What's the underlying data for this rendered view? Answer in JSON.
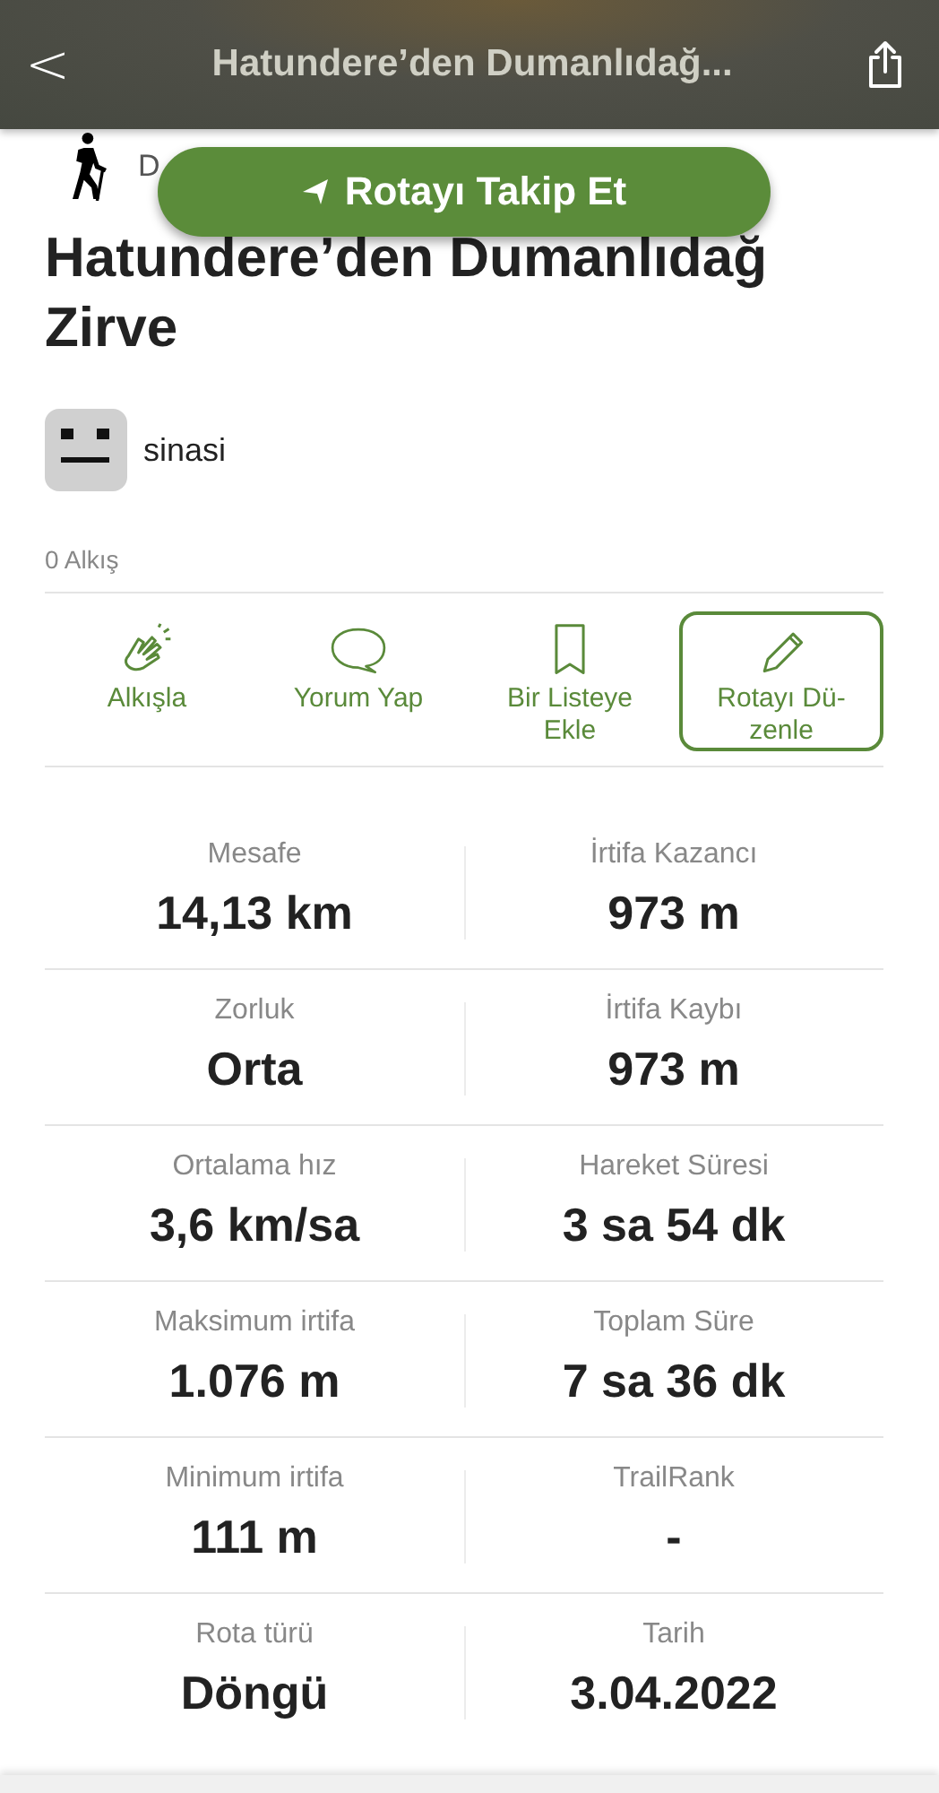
{
  "header": {
    "back": "<",
    "title": "Hatundere’den Dumanlıdağ..."
  },
  "activity": {
    "label": "D"
  },
  "follow_button": {
    "label": "Rotayı Takip Et"
  },
  "title": "Hatundere’den Dumanlıdağ Zirve",
  "author": {
    "name": "sinasi"
  },
  "claps": "0 Alkış",
  "actions": [
    {
      "kind": "clap",
      "label": "Alkışla",
      "selected": false
    },
    {
      "kind": "comment",
      "label": "Yorum Yap",
      "selected": false
    },
    {
      "kind": "bookmark",
      "label": "Bir Listeye Ekle",
      "selected": false
    },
    {
      "kind": "edit",
      "label": "Rotayı Dü-zenle",
      "selected": true
    }
  ],
  "stats": [
    {
      "label": "Mesafe",
      "value": "14,13 km"
    },
    {
      "label": "İrtifa Kazancı",
      "value": "973 m"
    },
    {
      "label": "Zorluk",
      "value": "Orta"
    },
    {
      "label": "İrtifa Kaybı",
      "value": "973 m"
    },
    {
      "label": "Ortalama hız",
      "value": "3,6 km/sa"
    },
    {
      "label": "Hareket Süresi",
      "value": "3 sa 54 dk"
    },
    {
      "label": "Maksimum irtifa",
      "value": "1.076 m"
    },
    {
      "label": "Toplam Süre",
      "value": "7 sa 36 dk"
    },
    {
      "label": "Minimum irtifa",
      "value": "111 m"
    },
    {
      "label": "TrailRank",
      "value": "-"
    },
    {
      "label": "Rota türü",
      "value": "Döngü"
    },
    {
      "label": "Tarih",
      "value": "3.04.2022"
    }
  ]
}
